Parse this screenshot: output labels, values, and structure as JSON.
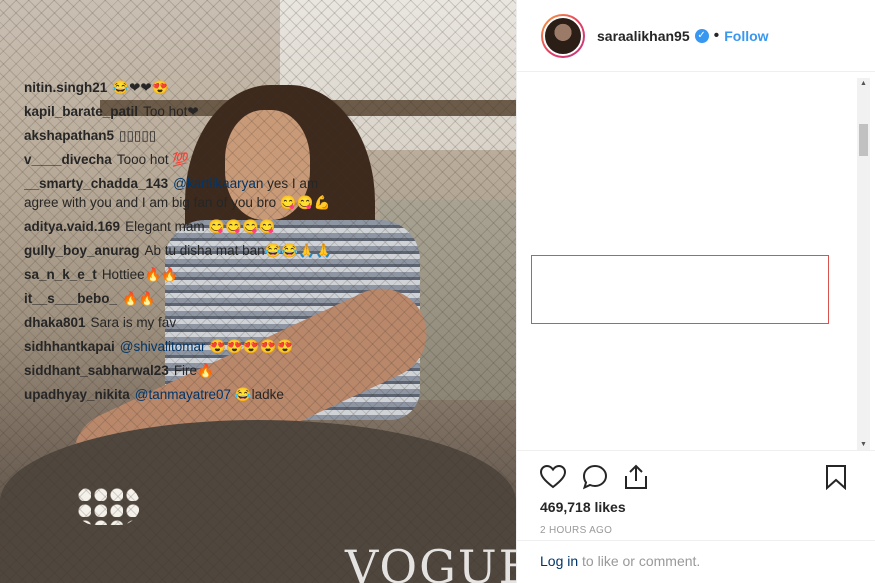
{
  "post": {
    "image_overlay_text": "VOGUE",
    "account": {
      "username": "saraalikhan95",
      "verified_mark": "✓",
      "separator": "•",
      "follow_label": "Follow"
    },
    "comments": [
      {
        "user": "nitin.singh21",
        "text": "😂❤❤😍"
      },
      {
        "user": "kapil_barate_patil",
        "text": "Too hot❤"
      },
      {
        "user": "akshapathan5",
        "text": "▯▯▯▯▯"
      },
      {
        "user": "v____divecha",
        "text": "Tooo hot 💯"
      },
      {
        "user": "__smarty_chadda_143",
        "mention": "@kartiikaaryan",
        "text": " yes I am agree with you and I am big fan of you bro 😋😋💪"
      },
      {
        "user": "aditya.vaid.169",
        "text": "Elegant mam 😋😋😋😋"
      },
      {
        "user": "gully_boy_anurag",
        "text": "Ab tu disha mat ban😂😂🙏🙏"
      },
      {
        "user": "sa_n_k_e_t",
        "text": "Hottiee🔥🔥"
      },
      {
        "user": "it__s___bebo_",
        "text": "🔥🔥"
      },
      {
        "user": "dhaka801",
        "text": "Sara is my fav"
      },
      {
        "user": "sidhhantkapai",
        "mention": "@shivalitomar",
        "text": " 😍😍😍😍😍"
      },
      {
        "user": "siddhant_sabharwal23",
        "text": "Fire🔥"
      },
      {
        "user": "upadhyay_nikita",
        "mention": "@tanmayatre07",
        "text": " 😂ladke"
      }
    ],
    "likes": "469,718 likes",
    "time": "2 hours ago",
    "login": {
      "link": "Log in",
      "rest": " to like or comment."
    },
    "colors": {
      "accent": "#3897f0",
      "highlight_border": "#d9534f",
      "mention": "#003569"
    },
    "icons": [
      "heart-icon",
      "comment-icon",
      "share-icon",
      "bookmark-icon"
    ]
  }
}
